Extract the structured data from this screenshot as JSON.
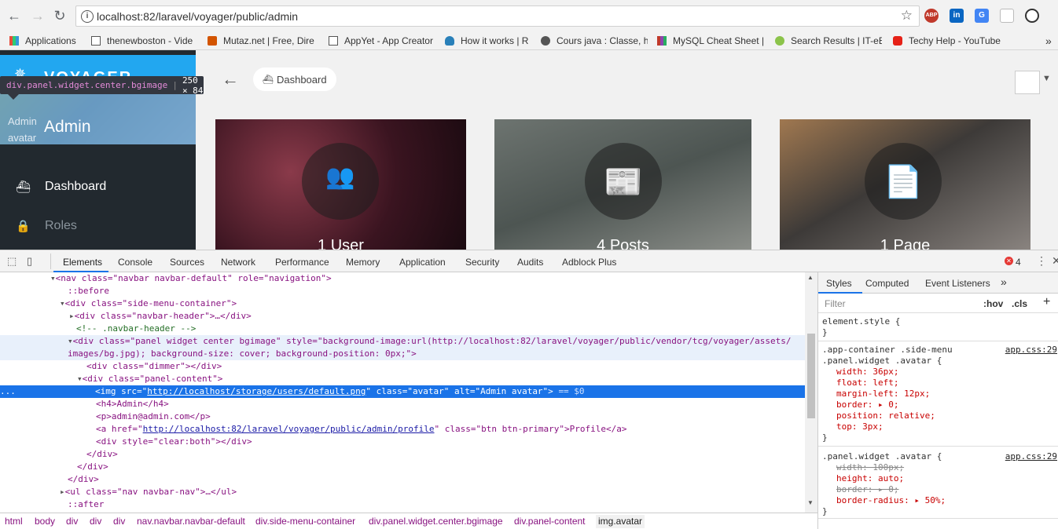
{
  "browser": {
    "url": "localhost:82/laravel/voyager/public/admin",
    "extensions": [
      "ABP",
      "in",
      "G",
      "",
      ""
    ],
    "bookmarks": [
      "Applications",
      "thenewboston - Vide",
      "Mutaz.net | Free, Dire",
      "AppYet - App Creator",
      "How it works | R",
      "Cours java : Classe, hé",
      "MySQL Cheat Sheet |",
      "Search Results | IT-eB",
      "Techy Help - YouTube"
    ],
    "more": "»"
  },
  "app": {
    "brand": "VOYAGER",
    "avatar_alt": "Admin avatar",
    "user_name": "Admin",
    "menu": [
      {
        "label": "Dashboard",
        "icon": "boat-icon",
        "active": true
      },
      {
        "label": "Roles",
        "icon": "lock-icon",
        "active": false
      }
    ],
    "breadcrumb": "Dashboard",
    "cards": [
      {
        "label": "1 User",
        "icon": "users-icon"
      },
      {
        "label": "4 Posts",
        "icon": "news-icon"
      },
      {
        "label": "1 Page",
        "icon": "file-text-icon"
      }
    ]
  },
  "tooltip": {
    "selector": "div.panel.widget.center.bgimage",
    "size": "250 × 84"
  },
  "devtools": {
    "tabs": [
      "Elements",
      "Console",
      "Sources",
      "Network",
      "Performance",
      "Memory",
      "Application",
      "Security",
      "Audits",
      "Adblock Plus"
    ],
    "active_tab": "Elements",
    "error_count": "4",
    "breadcrumbs": [
      "html",
      "body",
      "div",
      "div",
      "div",
      "nav.navbar.navbar-default",
      "div.side-menu-container",
      "div.panel.widget.center.bgimage",
      "div.panel-content",
      "img.avatar"
    ],
    "dom": {
      "nav_open": "<nav class=\"navbar navbar-default\" role=\"navigation\">",
      "before": "::before",
      "smc_open": "<div class=\"side-menu-container\">",
      "navbar_header": "<div class=\"navbar-header\">…</div>",
      "comment": "<!-- .navbar-header -->",
      "panel_open_1": "<div class=\"panel widget center bgimage\" style=\"background-image:url(http://localhost:82/laravel/voyager/public/vendor/tcg/voyager/assets/",
      "panel_open_2": "images/bg.jpg); background-size: cover; background-position: 0px;\">",
      "dimmer": "<div class=\"dimmer\"></div>",
      "panel_content_open": "<div class=\"panel-content\">",
      "img_pre": "<img src=\"",
      "img_src": "http://localhost/storage/users/default.png",
      "img_post": "\" class=\"avatar\" alt=\"Admin avatar\">",
      "img_eq": "== $0",
      "h4": "<h4>Admin</h4>",
      "p": "<p>admin@admin.com</p>",
      "a_pre": "<a href=\"",
      "a_href": "http://localhost:82/laravel/voyager/public/admin/profile",
      "a_post": "\" class=\"btn btn-primary\">Profile</a>",
      "clear": "<div style=\"clear:both\"></div>",
      "div_close": "</div>",
      "ul": "<ul class=\"nav navbar-nav\">…</ul>",
      "after": "::after",
      "ellipsis": "..."
    },
    "styles_tabs": [
      "Styles",
      "Computed",
      "Event Listeners",
      "»"
    ],
    "filter_placeholder": "Filter",
    "hov": ":hov",
    "cls": ".cls",
    "plus": "+",
    "rules": {
      "element_style": "element.style {",
      "close": "}",
      "rule1_sel1": ".app-container .side-menu",
      "rule1_sel2": ".panel.widget .avatar {",
      "rule1_src": "app.css:29",
      "rule1_props": [
        "width: 36px;",
        "float: left;",
        "margin-left: 12px;",
        "border: ▸ 0;",
        "position: relative;",
        "top: 3px;"
      ],
      "rule2_sel": ".panel.widget .avatar {",
      "rule2_src": "app.css:29",
      "rule2_props": [
        "width: 100px;",
        "height: auto;",
        "border: ▸ 0;",
        "border-radius: ▸ 50%;"
      ]
    }
  }
}
